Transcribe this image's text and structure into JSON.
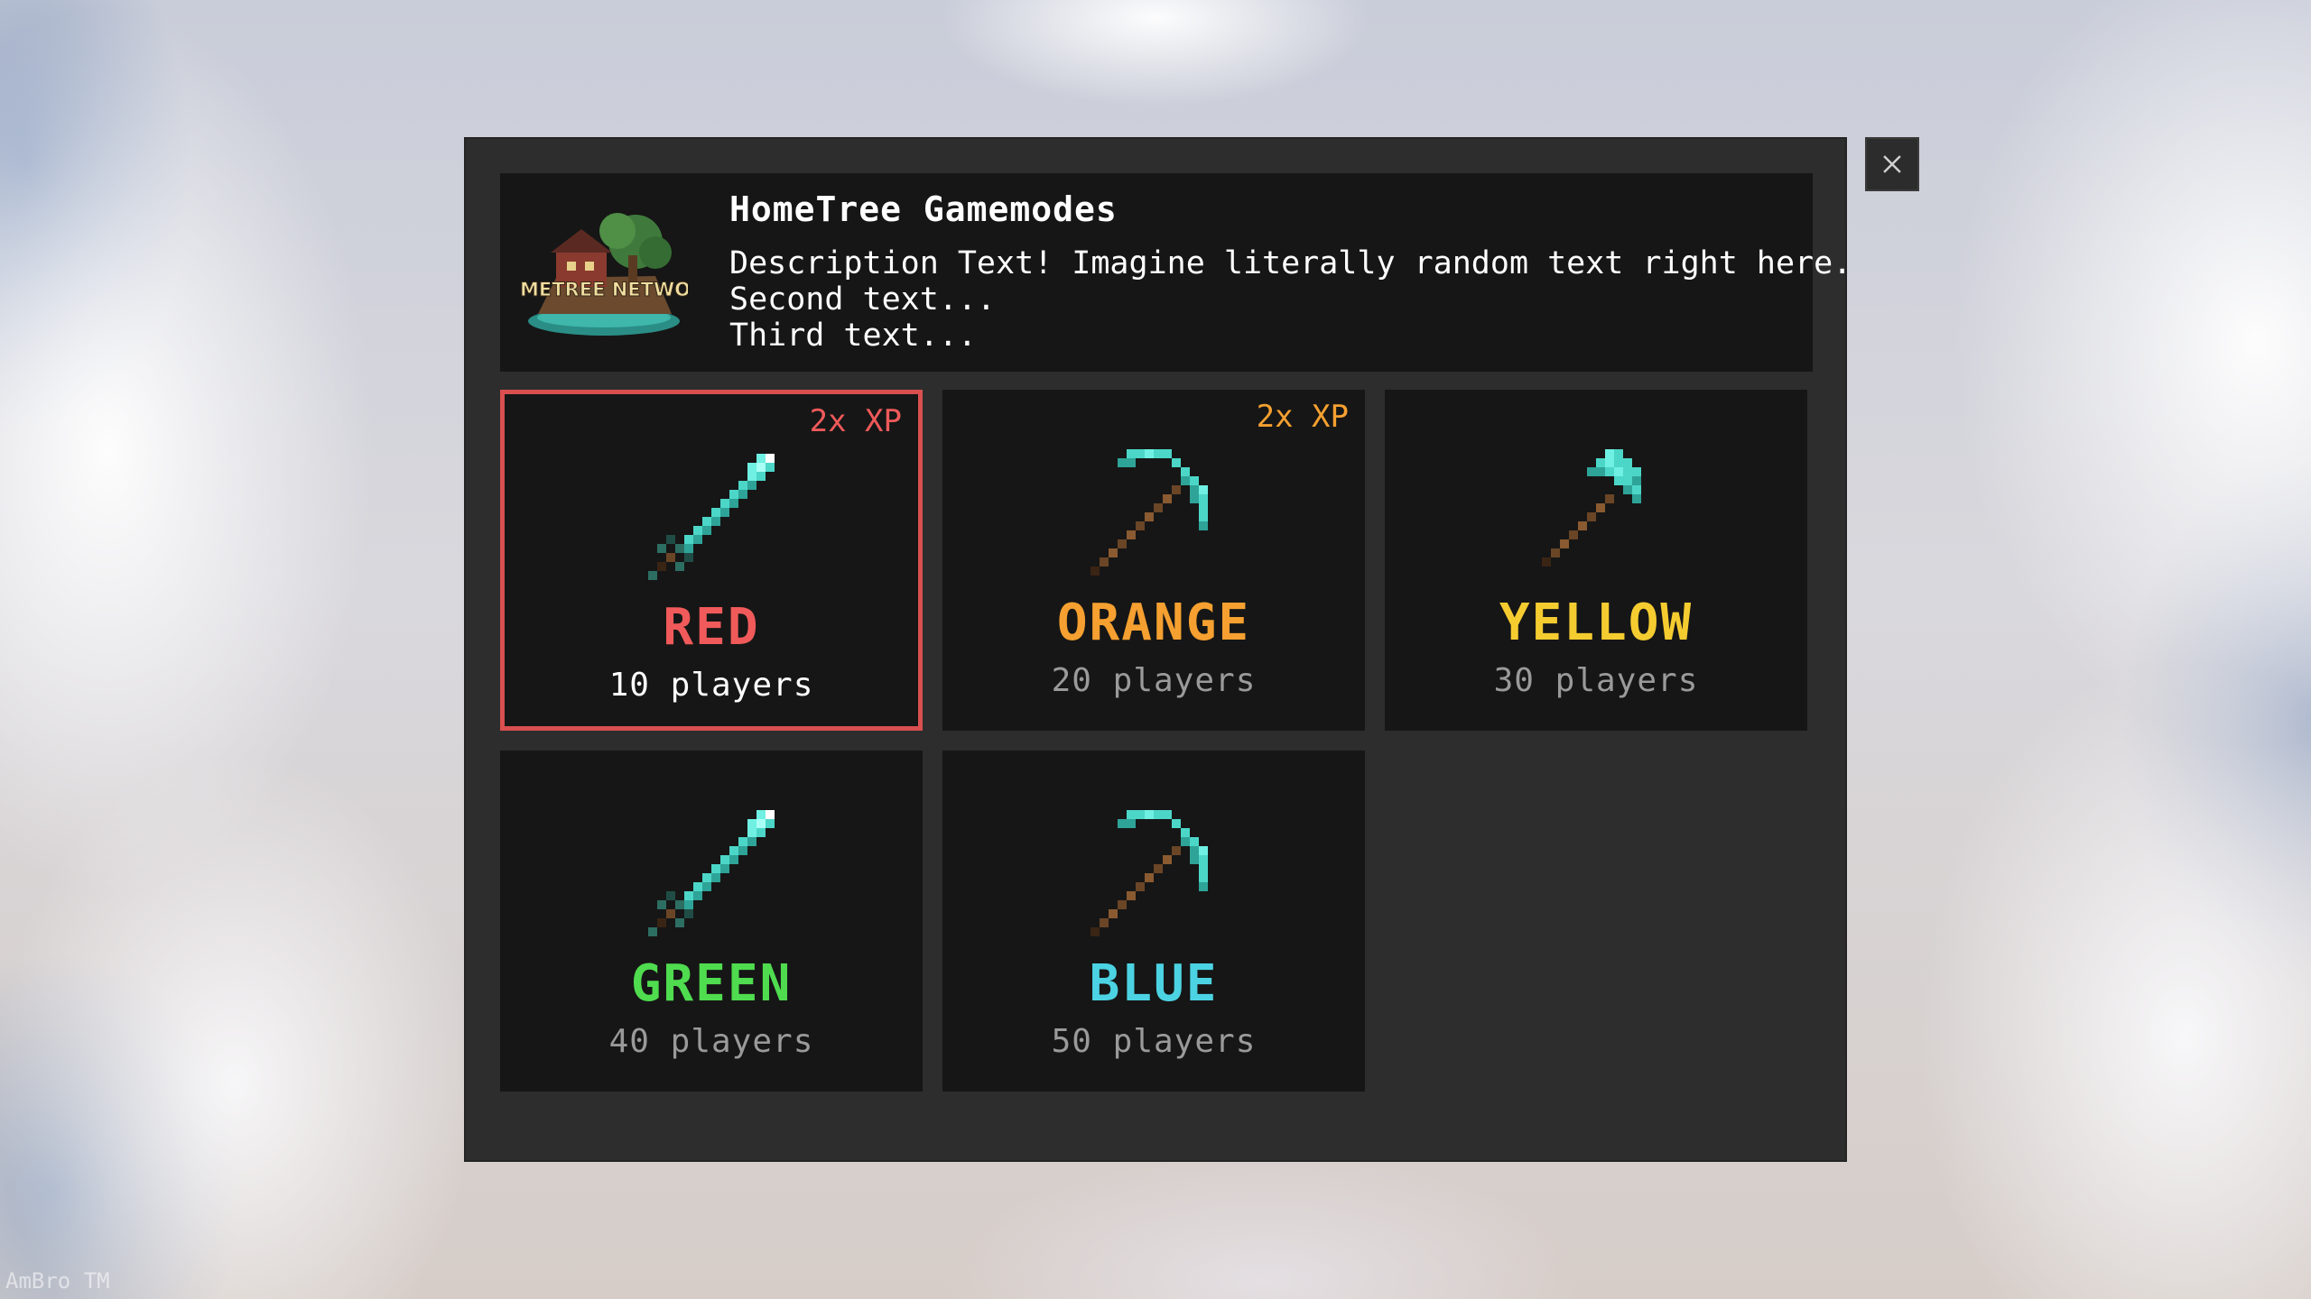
{
  "header": {
    "title": "HomeTree Gamemodes",
    "logo_text": "HOMETREE NETWORK",
    "description": [
      "Description Text! Imagine literally random text right here.",
      "Second text...",
      "Third text..."
    ]
  },
  "close_label": "×",
  "modes": [
    {
      "name": "RED",
      "players": "10 players",
      "badge": "2x XP",
      "icon": "sword-icon",
      "name_color": "#f05a5a",
      "badge_color": "#f05a5a",
      "players_color": "#ffffff",
      "selected": true
    },
    {
      "name": "ORANGE",
      "players": "20 players",
      "badge": "2x XP",
      "icon": "pickaxe-icon",
      "name_color": "#f5a030",
      "badge_color": "#f5a030",
      "players_color": "#9a9a9a",
      "selected": false
    },
    {
      "name": "YELLOW",
      "players": "30 players",
      "badge": "",
      "icon": "axe-icon",
      "name_color": "#f5cc30",
      "badge_color": "",
      "players_color": "#9a9a9a",
      "selected": false
    },
    {
      "name": "GREEN",
      "players": "40 players",
      "badge": "",
      "icon": "sword-icon",
      "name_color": "#4fdc4f",
      "badge_color": "",
      "players_color": "#9a9a9a",
      "selected": false
    },
    {
      "name": "BLUE",
      "players": "50 players",
      "badge": "",
      "icon": "pickaxe-icon",
      "name_color": "#4cd3e3",
      "badge_color": "",
      "players_color": "#9a9a9a",
      "selected": false
    }
  ],
  "watermark": "AmBro TM"
}
